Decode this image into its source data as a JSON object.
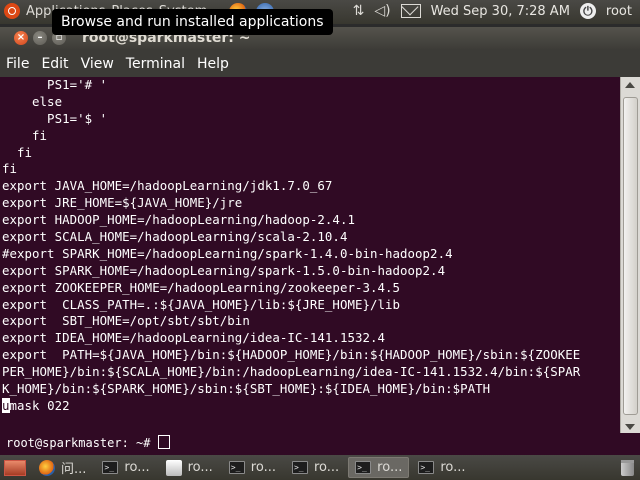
{
  "top_panel": {
    "menus": [
      "Applications",
      "Places",
      "System"
    ],
    "launchers": [
      "firefox-icon",
      "help-icon"
    ],
    "clock": "Wed Sep 30,  7:28 AM",
    "user": "root",
    "indicators": [
      "network-icon",
      "volume-icon",
      "mail-icon"
    ]
  },
  "tooltip": "Browse and run installed applications",
  "window": {
    "title": "root@sparkmaster: ~",
    "menu": [
      "File",
      "Edit",
      "View",
      "Terminal",
      "Help"
    ]
  },
  "terminal": {
    "lines": [
      "      PS1='# '",
      "    else",
      "      PS1='$ '",
      "    fi",
      "  fi",
      "fi",
      "export JAVA_HOME=/hadoopLearning/jdk1.7.0_67",
      "export JRE_HOME=${JAVA_HOME}/jre",
      "export HADOOP_HOME=/hadoopLearning/hadoop-2.4.1",
      "export SCALA_HOME=/hadoopLearning/scala-2.10.4",
      "#export SPARK_HOME=/hadoopLearning/spark-1.4.0-bin-hadoop2.4",
      "export SPARK_HOME=/hadoopLearning/spark-1.5.0-bin-hadoop2.4",
      "export ZOOKEEPER_HOME=/hadoopLearning/zookeeper-3.4.5",
      "export  CLASS_PATH=.:${JAVA_HOME}/lib:${JRE_HOME}/lib",
      "export  SBT_HOME=/opt/sbt/sbt/bin",
      "export IDEA_HOME=/hadoopLearning/idea-IC-141.1532.4",
      "export  PATH=${JAVA_HOME}/bin:${HADOOP_HOME}/bin:${HADOOP_HOME}/sbin:${ZOOKEE",
      "PER_HOME}/bin:${SCALA_HOME}/bin:/hadoopLearning/idea-IC-141.1532.4/bin:${SPAR",
      "K_HOME}/bin:${SPARK_HOME}/sbin:${SBT_HOME}:${IDEA_HOME}/bin:$PATH"
    ],
    "cursor_line_char": "u",
    "cursor_line_rest": "mask 022",
    "underlay_prompt": "root@sparkmaster: ~# "
  },
  "taskbar": {
    "tasks": [
      {
        "icon": "firefox-icon",
        "label": "问..."
      },
      {
        "icon": "terminal-icon",
        "label": "ro..."
      },
      {
        "icon": "app-icon",
        "label": "ro..."
      },
      {
        "icon": "terminal-icon",
        "label": "ro..."
      },
      {
        "icon": "terminal-icon",
        "label": "ro..."
      },
      {
        "icon": "terminal-icon",
        "label": "ro..."
      },
      {
        "icon": "terminal-icon",
        "label": "ro..."
      },
      {
        "icon": "terminal-icon",
        "label": ""
      }
    ]
  },
  "colors": {
    "terminal_bg": "#300a24",
    "panel_bg": "#3c3b37",
    "terminal_fg": "#ffffff"
  }
}
